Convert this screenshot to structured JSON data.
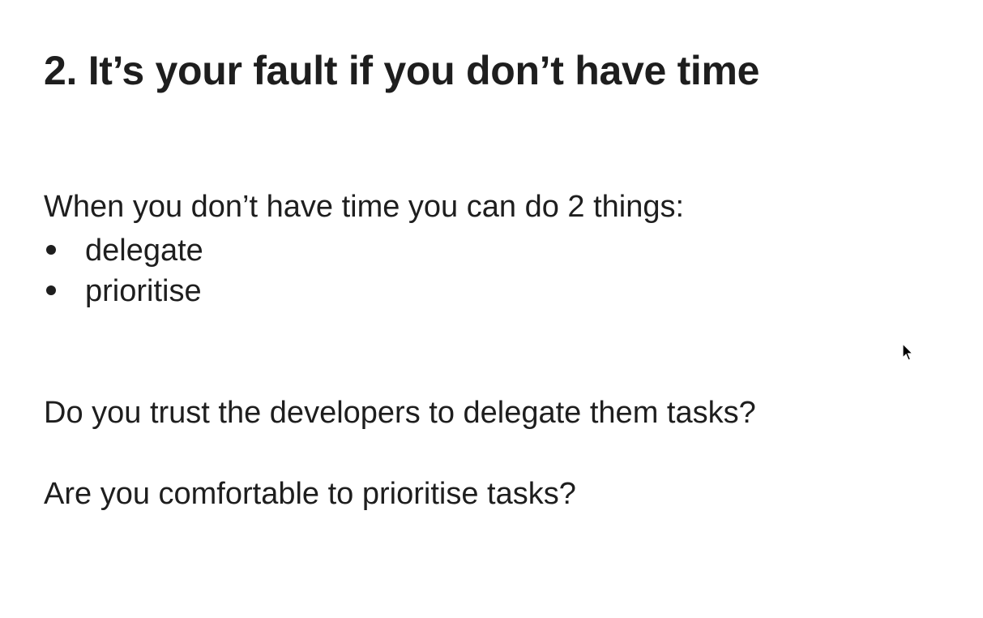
{
  "slide": {
    "title": "2. It’s your fault if you don’t have time",
    "intro": "When you don’t have time you can do 2 things:",
    "bullets": [
      "delegate",
      "prioritise"
    ],
    "questions": [
      "Do you trust the developers to delegate them tasks?",
      "Are you comfortable to prioritise tasks?"
    ]
  }
}
